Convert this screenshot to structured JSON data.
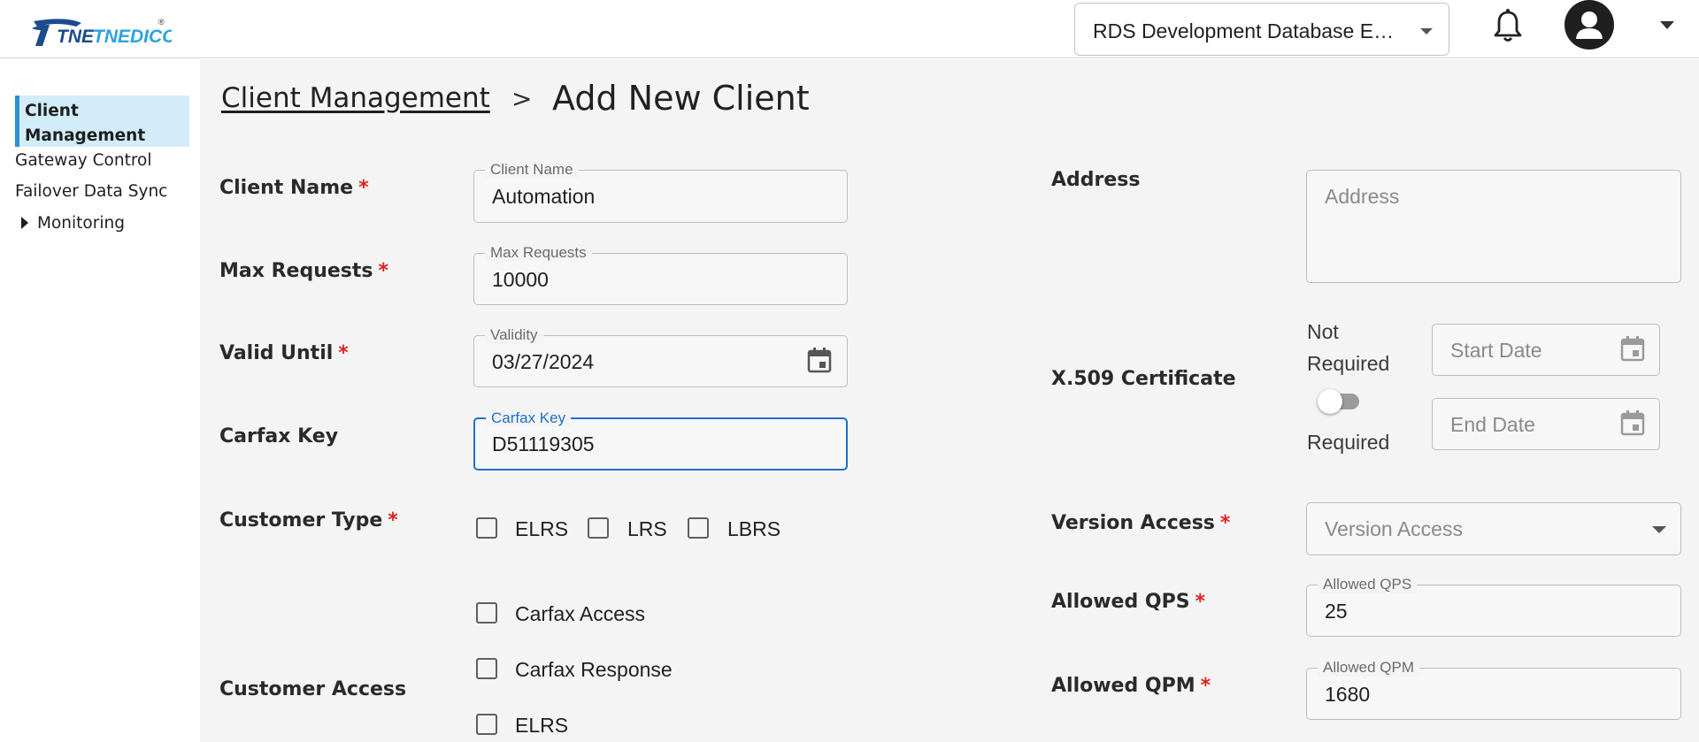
{
  "header": {
    "logo_text": "TNEDICCA",
    "logo_mark": "®",
    "database_selector": {
      "value": "RDS Development Database ELRS"
    },
    "bell_icon": "bell-icon",
    "avatar_icon": "user-avatar-icon",
    "user_menu_icon": "chevron-down-icon"
  },
  "sidebar": {
    "items": [
      {
        "label": "Client Management",
        "active": true
      },
      {
        "label": "Gateway Control"
      },
      {
        "label": "Failover Data Sync"
      },
      {
        "label": "Monitoring",
        "expandable": true
      }
    ]
  },
  "breadcrumb": {
    "parent": "Client Management",
    "separator": ">",
    "current": "Add New Client"
  },
  "form": {
    "client_name": {
      "label": "Client Name",
      "required_mark": "*",
      "legend": "Client Name",
      "value": "Automation"
    },
    "max_requests": {
      "label": "Max Requests",
      "required_mark": "*",
      "legend": "Max Requests",
      "value": "10000"
    },
    "valid_until": {
      "label": "Valid Until",
      "required_mark": "*",
      "legend": "Validity",
      "value": "03/27/2024"
    },
    "carfax_key": {
      "label": "Carfax Key",
      "legend": "Carfax Key",
      "value": "D51119305"
    },
    "customer_type": {
      "label": "Customer Type",
      "required_mark": "*",
      "options": [
        {
          "label": "ELRS",
          "checked": false
        },
        {
          "label": "LRS",
          "checked": false
        },
        {
          "label": "LBRS",
          "checked": false
        }
      ]
    },
    "customer_access": {
      "label": "Customer Access",
      "options": [
        {
          "label": "Carfax Access",
          "checked": false
        },
        {
          "label": "Carfax Response",
          "checked": false
        },
        {
          "label": "ELRS",
          "checked": false
        }
      ]
    },
    "address": {
      "label": "Address",
      "placeholder": "Address"
    },
    "x509": {
      "label": "X.509 Certificate",
      "toggle_off_label": "Not Required",
      "toggle_on_label": "Required",
      "toggle_on": false,
      "start_date_placeholder": "Start Date",
      "end_date_placeholder": "End Date"
    },
    "version_access": {
      "label": "Version Access",
      "required_mark": "*",
      "placeholder": "Version Access"
    },
    "allowed_qps": {
      "label": "Allowed QPS",
      "required_mark": "*",
      "legend": "Allowed QPS",
      "value": "25"
    },
    "allowed_qpm": {
      "label": "Allowed QPM",
      "required_mark": "*",
      "legend": "Allowed QPM",
      "value": "1680"
    }
  },
  "colors": {
    "accent": "#1f6fc9",
    "active_nav_bg": "#d2ecfa",
    "active_nav_border": "#2b8fd6",
    "required": "#e02020",
    "main_bg": "#f4f4f4"
  }
}
